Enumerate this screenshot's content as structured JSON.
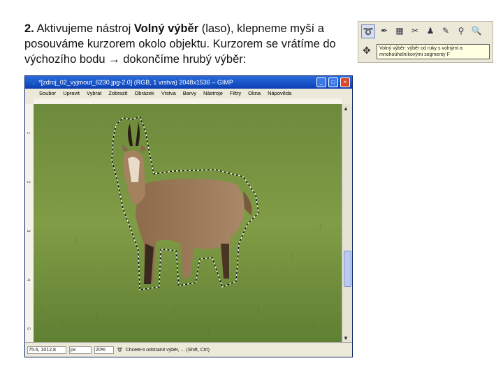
{
  "instruction": {
    "number": "2.",
    "part1": " Aktivujeme nástroj ",
    "tool_name": "Volný výběr",
    "part2": " (laso), klepneme myší a posouváme kurzorem okolo objektu. Kurzorem se vrátíme do výchozího bodu ",
    "arrow": "→",
    "part3": "  dokončíme hrubý výběr:"
  },
  "toolbox": {
    "tools": [
      "lasso-icon",
      "wand-icon",
      "color-select-icon",
      "scissors-icon",
      "foreground-select-icon",
      "paths-icon",
      "color-picker-icon",
      "zoom-icon"
    ],
    "tooltip": "Volný výběr: výběr od ruky s volnými a mnohoúhelníkovými segmenty  F"
  },
  "gimp": {
    "title": "*[zdroj_02_vyjmout_6230.jpg-2.0] (RGB, 1 vrstva) 2048x1536 – GIMP",
    "menu": [
      "Soubor",
      "Upravit",
      "Vybrat",
      "Zobrazit",
      "Obrázek",
      "Vrstva",
      "Barvy",
      "Nástroje",
      "Filtry",
      "Okna",
      "Nápověda"
    ],
    "ruler_marks": [
      "0",
      "1",
      "2",
      "3",
      "4",
      "5",
      "6",
      "7"
    ],
    "status": {
      "coords": "75.6, 1012.8",
      "unit": "px",
      "zoom": "20%",
      "message": "Chcete-li odstranit výběr, ... (Shift, Ctrl)"
    }
  },
  "colors": {
    "grass": "#7f9a45",
    "chamois": "#9c7b5a",
    "titlebar": "#0b3fb5"
  }
}
